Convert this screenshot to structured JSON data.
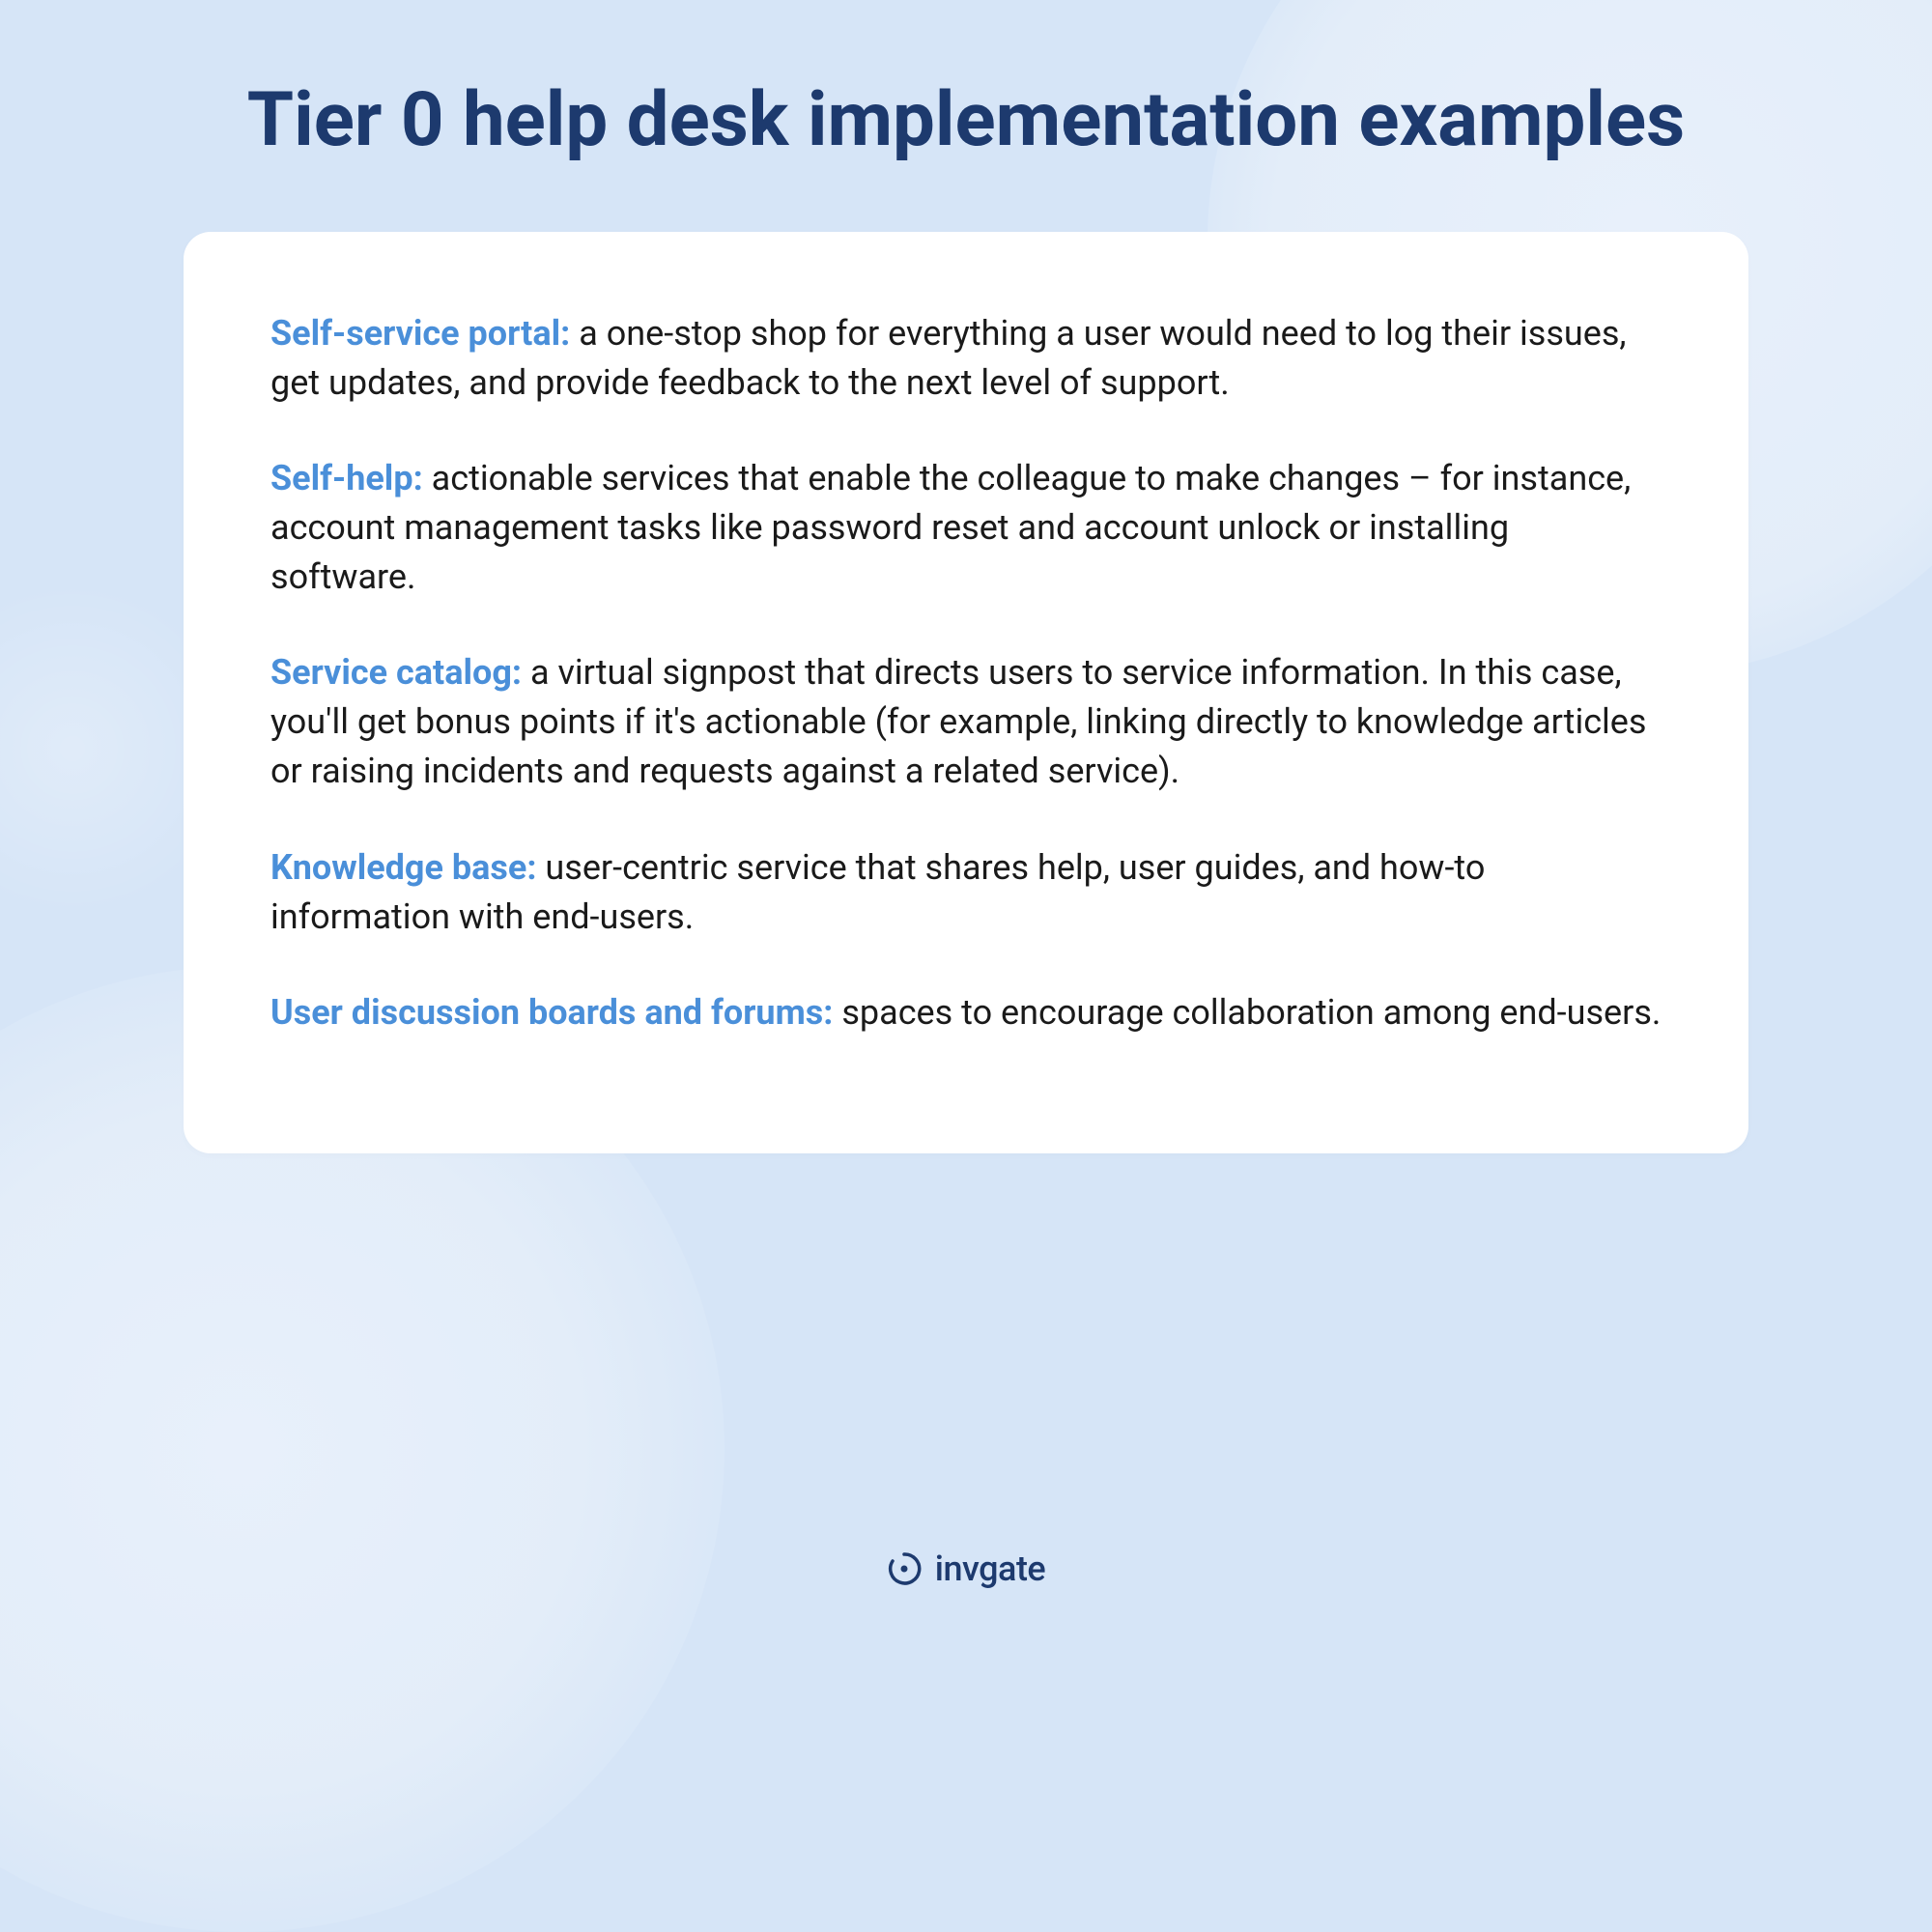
{
  "title": "Tier 0 help desk implementation examples",
  "items": [
    {
      "label": "Self-service portal:",
      "text": " a one-stop shop for everything a user would need to log their issues, get updates, and provide feedback to the next level of support."
    },
    {
      "label": "Self-help:",
      "text": " actionable services that enable the colleague to make changes – for instance, account management tasks like password reset and account unlock or installing software."
    },
    {
      "label": "Service catalog:",
      "text": " a virtual signpost that directs users to service information. In this case, you'll get bonus points if it's actionable (for example, linking directly to knowledge articles or raising incidents and requests against a related service)."
    },
    {
      "label": "Knowledge base:",
      "text": " user-centric service that shares help, user guides, and how-to information with end-users."
    },
    {
      "label": "User discussion boards and forums:",
      "text": " spaces to encourage collaboration among end-users."
    }
  ],
  "footer": {
    "brand": "invgate"
  }
}
